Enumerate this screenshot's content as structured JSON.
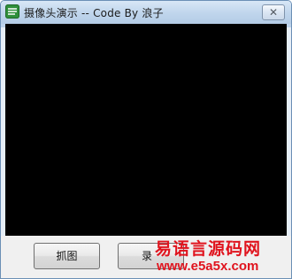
{
  "window": {
    "title": "摄像头演示 -- Code By 浪子",
    "app_icon": "app-icon",
    "close_icon": "close-icon",
    "close_glyph": "✕"
  },
  "buttons": {
    "capture_label": "抓图",
    "record_label": "录"
  },
  "watermark": {
    "line1": "易语言源码网",
    "line2": "www.e5a5x.com",
    "color": "#e0141e"
  }
}
